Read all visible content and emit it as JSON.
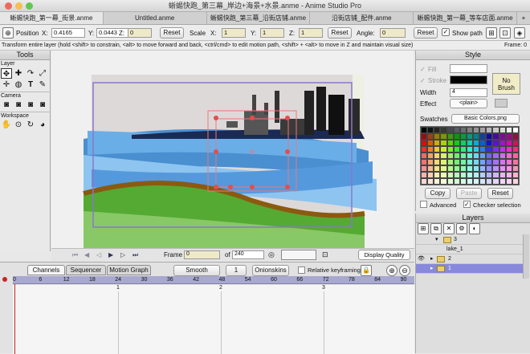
{
  "window": {
    "title": "蜥蜴快跑_第三幕_岸边+海景+水景.anme - Anime Studio Pro"
  },
  "tabs": [
    "蜥蜴快跑_第一幕_街景.anme",
    "Untitled.anme",
    "蜥蜴快跑_第三幕_沿街店铺.anme",
    "沿街店铺_配件.anme",
    "蜥蜴快跑_第一幕_等车店面.anme"
  ],
  "tab_add": "+",
  "options": {
    "position_label": "Position",
    "x_label": "X:",
    "x_value": "0.4165",
    "y_label": "Y:",
    "y_value": "0.0443",
    "z_label": "Z:",
    "z_value": "0",
    "reset1": "Reset",
    "scale_label": "Scale",
    "sx_label": "X:",
    "sx_value": "1",
    "sy_label": "Y:",
    "sy_value": "1",
    "sz_label": "Z:",
    "sz_value": "1",
    "reset2": "Reset",
    "angle_label": "Angle:",
    "angle_value": "0",
    "reset3": "Reset",
    "show_path": "Show path"
  },
  "status": {
    "hint": "Transform entire layer (hold <shift> to constrain, <alt> to move forward and back, <ctrl/cmd> to edit motion path, <shift> + <alt> to move in Z and maintain visual size)",
    "frame": "Frame: 0"
  },
  "tools": {
    "title": "Tools",
    "layer": "Layer",
    "camera": "Camera",
    "workspace": "Workspace"
  },
  "style": {
    "title": "Style",
    "fill": "Fill",
    "stroke": "Stroke",
    "no_brush": "No Brush",
    "width_label": "Width",
    "width_value": "4",
    "effect_label": "Effect",
    "effect_value": "<plain>",
    "swatches_label": "Swatches",
    "swatches_value": "Basic Colors.png",
    "copy": "Copy",
    "paste": "Paste",
    "reset": "Reset",
    "advanced": "Advanced",
    "checker": "Checker selection"
  },
  "layers": {
    "title": "Layers",
    "rows": [
      {
        "name": "3"
      },
      {
        "name": "lake_1"
      },
      {
        "name": "2"
      },
      {
        "name": "1"
      }
    ]
  },
  "controls": {
    "frame_label": "Frame",
    "frame_value": "0",
    "of_label": "of",
    "total": "240",
    "quality": "Display Quality"
  },
  "timeline": {
    "tabs": [
      "Channels",
      "Sequencer",
      "Motion Graph"
    ],
    "smooth": "Smooth",
    "step": "1",
    "onionskins": "Onionskins",
    "relative": "Relative keyframing",
    "ruler": [
      "0",
      "6",
      "12",
      "18",
      "24",
      "30",
      "36",
      "42",
      "48",
      "54",
      "60",
      "66",
      "72",
      "78",
      "84",
      "90"
    ],
    "seconds": [
      "1",
      "2",
      "3"
    ]
  },
  "colors": {
    "accent": "#4a6fd8",
    "ruler": "#a8a8d0",
    "selection": "#8888dd"
  }
}
